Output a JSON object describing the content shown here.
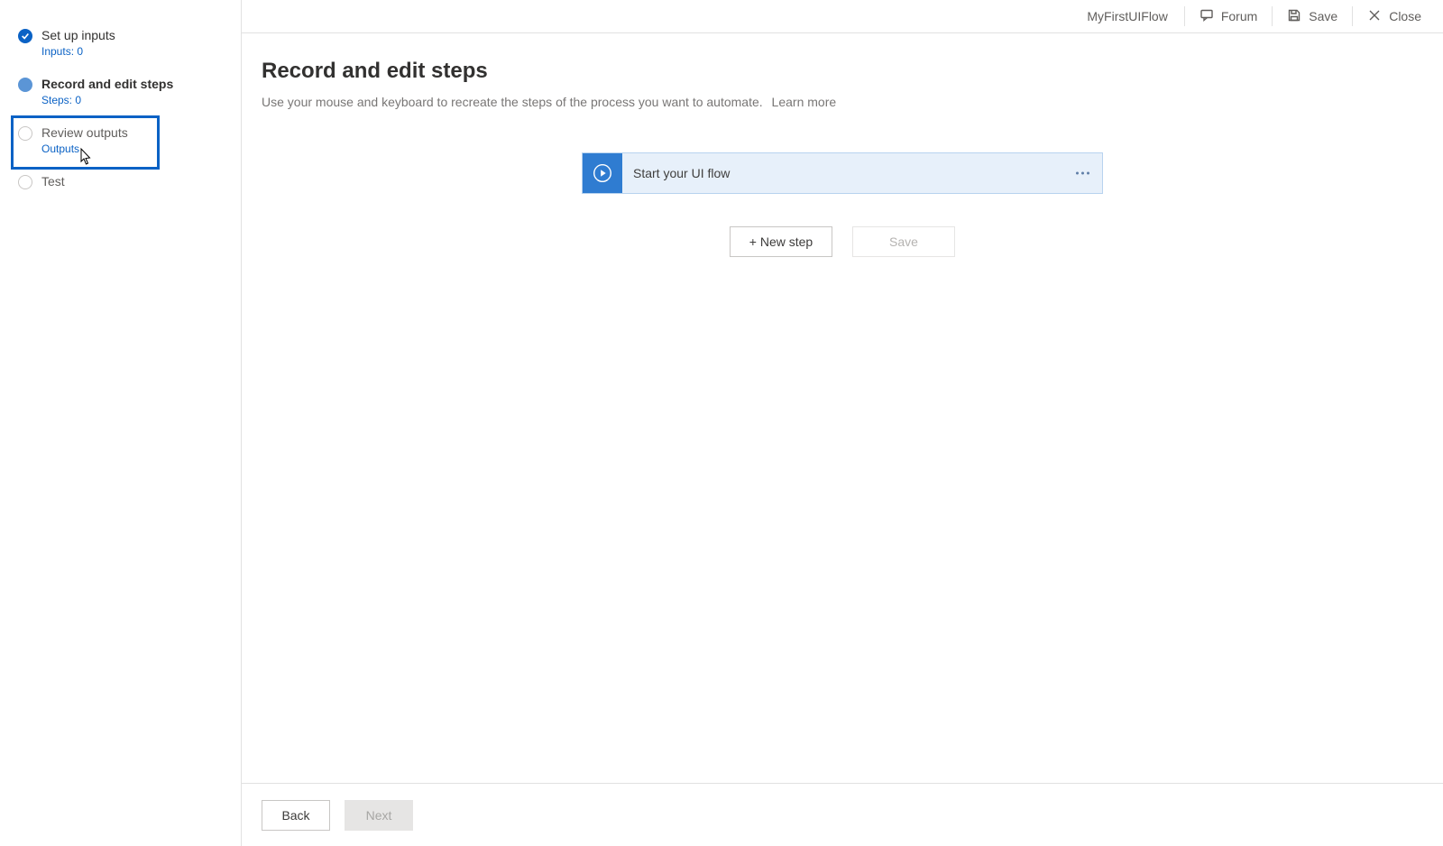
{
  "topbar": {
    "flow_name": "MyFirstUIFlow",
    "forum": "Forum",
    "save": "Save",
    "close": "Close"
  },
  "sidebar": {
    "steps": [
      {
        "label": "Set up inputs",
        "sub": "Inputs: 0"
      },
      {
        "label": "Record and edit steps",
        "sub": "Steps: 0"
      },
      {
        "label": "Review outputs",
        "sub": "Outputs"
      },
      {
        "label": "Test",
        "sub": ""
      }
    ]
  },
  "main": {
    "title": "Record and edit steps",
    "description": "Use your mouse and keyboard to recreate the steps of the process you want to automate.",
    "learn_more": "Learn more",
    "flow_card_title": "Start your UI flow",
    "new_step": "+ New step",
    "save": "Save"
  },
  "footer": {
    "back": "Back",
    "next": "Next"
  }
}
